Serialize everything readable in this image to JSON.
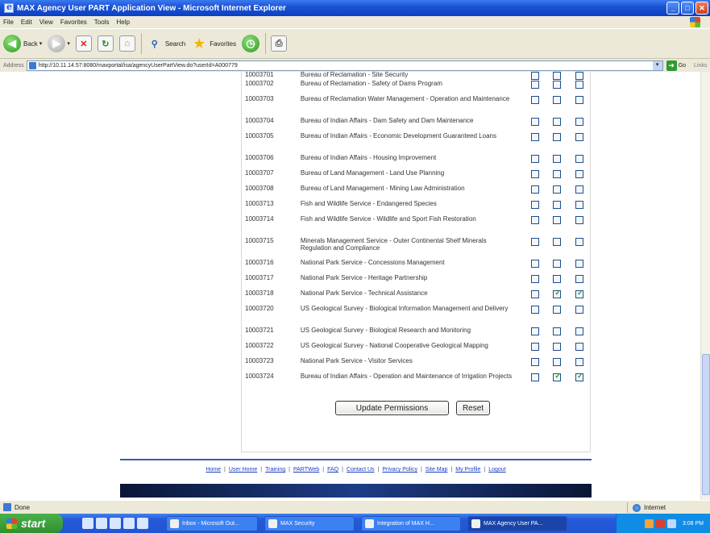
{
  "window": {
    "title": "MAX Agency User PART Application View - Microsoft Internet Explorer"
  },
  "menu": [
    "File",
    "Edit",
    "View",
    "Favorites",
    "Tools",
    "Help"
  ],
  "toolbar": {
    "back": "Back",
    "search": "Search",
    "favorites": "Favorites"
  },
  "address": {
    "label": "Address",
    "url": "http://10.11.14.57:8080/maxportal/isa/agencyUserPartView.do?userId=A000779",
    "go": "Go",
    "links": "Links"
  },
  "rows": [
    {
      "id": "10003701",
      "name": "Bureau of Reclamation - Site Security",
      "checks": [
        false,
        false,
        false
      ]
    },
    {
      "id": "10003702",
      "name": "Bureau of Reclamation - Safety of Dams Program",
      "checks": [
        false,
        false,
        false
      ]
    },
    {
      "id": "10003703",
      "name": "Bureau of Reclamation Water Management - Operation and Maintenance",
      "checks": [
        false,
        false,
        false
      ]
    },
    {
      "id": "10003704",
      "name": "Bureau of Indian Affairs - Dam Safety and Dam Maintenance",
      "checks": [
        false,
        false,
        false
      ]
    },
    {
      "id": "10003705",
      "name": "Bureau of Indian Affairs - Economic Development Guaranteed Loans",
      "checks": [
        false,
        false,
        false
      ]
    },
    {
      "id": "10003706",
      "name": "Bureau of Indian Affairs - Housing Improvement",
      "checks": [
        false,
        false,
        false
      ]
    },
    {
      "id": "10003707",
      "name": "Bureau of Land Management - Land Use Planning",
      "checks": [
        false,
        false,
        false
      ]
    },
    {
      "id": "10003708",
      "name": "Bureau of Land Management - Mining Law Administration",
      "checks": [
        false,
        false,
        false
      ]
    },
    {
      "id": "10003713",
      "name": "Fish and Wildlife Service - Endangered Species",
      "checks": [
        false,
        false,
        false
      ]
    },
    {
      "id": "10003714",
      "name": "Fish and Wildlife Service - Wildlife and Sport Fish Restoration",
      "checks": [
        false,
        false,
        false
      ]
    },
    {
      "id": "10003715",
      "name": "Minerals Management Service - Outer Continental Shelf Minerals Regulation and Compliance",
      "checks": [
        false,
        false,
        false
      ]
    },
    {
      "id": "10003716",
      "name": "National Park Service - Concessions Management",
      "checks": [
        false,
        false,
        false
      ]
    },
    {
      "id": "10003717",
      "name": "National Park Service - Heritage Partnership",
      "checks": [
        false,
        false,
        false
      ]
    },
    {
      "id": "10003718",
      "name": "National Park Service - Technical Assistance",
      "checks": [
        false,
        true,
        true
      ]
    },
    {
      "id": "10003720",
      "name": "US Geological Survey - Biological Information Management and Delivery",
      "checks": [
        false,
        false,
        false
      ]
    },
    {
      "id": "10003721",
      "name": "US Geological Survey - Biological Research and Monitoring",
      "checks": [
        false,
        false,
        false
      ]
    },
    {
      "id": "10003722",
      "name": "US Geological Survey - National Cooperative Geological Mapping",
      "checks": [
        false,
        false,
        false
      ]
    },
    {
      "id": "10003723",
      "name": "National Park Service - Visitor Services",
      "checks": [
        false,
        false,
        false
      ]
    },
    {
      "id": "10003724",
      "name": "Bureau of Indian Affairs - Operation and Maintenance of Irrigation Projects",
      "checks": [
        false,
        true,
        true
      ]
    }
  ],
  "buttons": {
    "update": "Update Permissions",
    "reset": "Reset"
  },
  "footer": {
    "links": [
      "Home",
      "User Home",
      "Training",
      "PARTWeb",
      "FAQ",
      "Contact Us",
      "Privacy Policy",
      "Site Map",
      "My Profile",
      "Logout"
    ],
    "separator": "|"
  },
  "status": {
    "text": "Done",
    "zone": "Internet"
  },
  "taskbar": {
    "start": "start",
    "tasks": [
      {
        "label": "Inbox - Microsoft Out...",
        "active": false
      },
      {
        "label": "MAX Security",
        "active": false
      },
      {
        "label": "Integration of MAX H...",
        "active": false
      },
      {
        "label": "MAX Agency User PA...",
        "active": true
      }
    ],
    "clock": "3:08 PM"
  },
  "colors": {
    "titlebar": "#1d54d6",
    "link": "#1a3fc2",
    "check": "#21a121",
    "footer_band": "#1d3c86"
  }
}
